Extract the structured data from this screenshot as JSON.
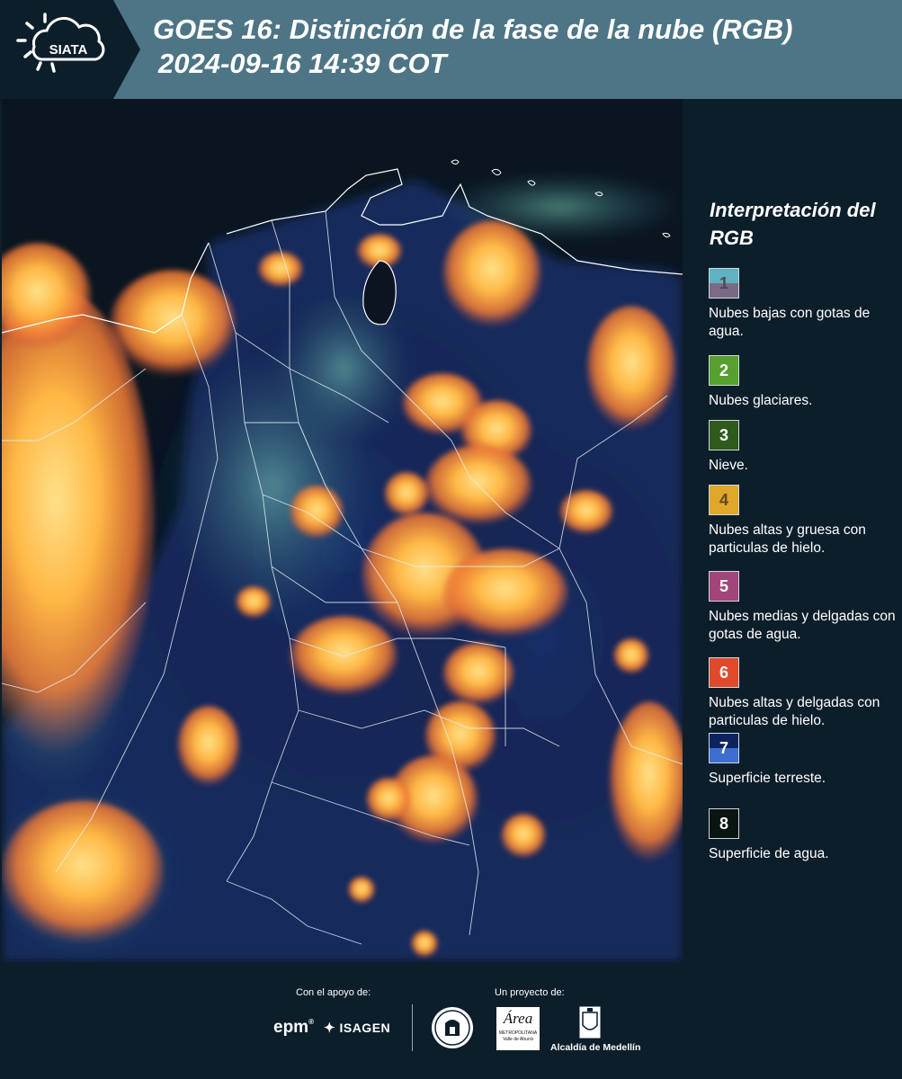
{
  "header": {
    "logo_text": "SIATA",
    "title_line1": "GOES 16: Distinción de la fase de la nube (RGB)",
    "title_line2": "2024-09-16 14:39 COT"
  },
  "legend": {
    "title": "Interpretación del RGB",
    "items": [
      {
        "num": "1",
        "label": "Nubes bajas con gotas de agua.",
        "color_top": "#5fb3c0",
        "color_bottom": "#7a6a86",
        "num_color": "#4a4a55"
      },
      {
        "num": "2",
        "label": "Nubes glaciares.",
        "color_top": "#55a02f",
        "color_bottom": "#55a02f",
        "num_color": "#ffffff"
      },
      {
        "num": "3",
        "label": "Nieve.",
        "color_top": "#2e5a1c",
        "color_bottom": "#2e5a1c",
        "num_color": "#ffffff"
      },
      {
        "num": "4",
        "label": "Nubes altas y gruesa con particulas de hielo.",
        "color_top": "#e0a82a",
        "color_bottom": "#e0a82a",
        "num_color": "#5a4a20"
      },
      {
        "num": "5",
        "label": "Nubes medias y delgadas con gotas de agua.",
        "color_top": "#a1457a",
        "color_bottom": "#a1457a",
        "num_color": "#ffffff"
      },
      {
        "num": "6",
        "label": "Nubes altas y delgadas con particulas de hielo.",
        "color_top": "#e04a2a",
        "color_bottom": "#e04a2a",
        "num_color": "#ffffff"
      },
      {
        "num": "7",
        "label": "Superficie terreste.",
        "color_top": "#0e2260",
        "color_bottom": "#3c6fd0",
        "num_color": "#ffffff"
      },
      {
        "num": "8",
        "label": "Superficie de agua.",
        "color_top": "#0a1410",
        "color_bottom": "#0a1410",
        "num_color": "#ffffff"
      }
    ]
  },
  "footer": {
    "support_caption": "Con el apoyo de:",
    "project_caption": "Un proyecto de:",
    "sponsor_epm": "epm",
    "sponsor_isagen": "ISAGEN",
    "area_logo_text": "Área",
    "area_logo_sub": "METROPOLITANA",
    "area_logo_sub2": "Valle de Aburrá",
    "alcaldia_label": "Alcaldía de Medellín"
  }
}
